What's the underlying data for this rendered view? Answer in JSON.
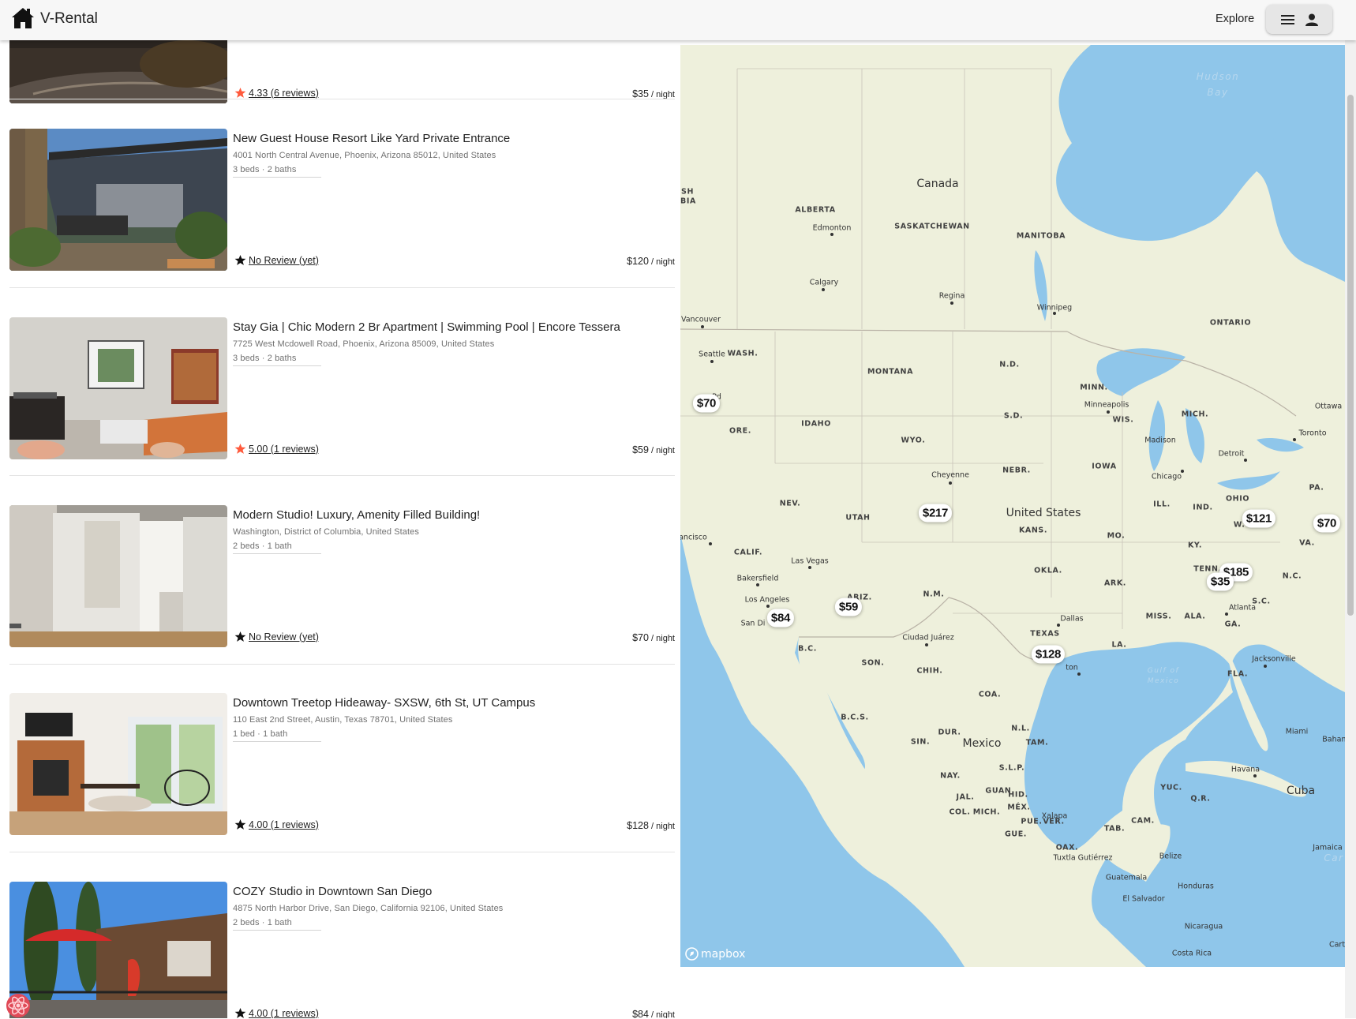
{
  "header": {
    "brand": "V-Rental",
    "explore_label": "Explore",
    "menu_icon": "hamburger-icon",
    "user_icon": "user-icon"
  },
  "listings": [
    {
      "title": "",
      "address": "",
      "beds": "",
      "rating": "4.33 (6 reviews)",
      "rated": true,
      "price": "$35",
      "per": " / night"
    },
    {
      "title": "New Guest House Resort Like Yard Private Entrance",
      "address": "4001 North Central Avenue, Phoenix, Arizona 85012, United States",
      "beds": "3 beds · 2 baths",
      "rating": "No Review (yet)",
      "rated": false,
      "price": "$120",
      "per": " / night"
    },
    {
      "title": "Stay Gia | Chic Modern 2 Br Apartment | Swimming Pool | Encore Tessera",
      "address": "7725 West Mcdowell Road, Phoenix, Arizona 85009, United States",
      "beds": "3 beds · 2 baths",
      "rating": "5.00 (1 reviews)",
      "rated": true,
      "price": "$59",
      "per": " / night"
    },
    {
      "title": "Modern Studio! Luxury, Amenity Filled Building!",
      "address": "Washington, District of Columbia, United States",
      "beds": "2 beds · 1 bath",
      "rating": "No Review (yet)",
      "rated": false,
      "price": "$70",
      "per": " / night"
    },
    {
      "title": "Downtown Treetop Hideaway- SXSW, 6th St, UT Campus",
      "address": "110 East 2nd Street, Austin, Texas 78701, United States",
      "beds": "1 bed · 1 bath",
      "rating": "4.00 (1 reviews)",
      "rated": false,
      "price": "$128",
      "per": " / night"
    },
    {
      "title": "COZY Studio in Downtown San Diego",
      "address": "4875 North Harbor Drive, San Diego, California 92106, United States",
      "beds": "2 beds · 1 bath",
      "rating": "4.00 (1 reviews)",
      "rated": false,
      "price": "$84",
      "per": " / night"
    }
  ],
  "colors": {
    "star_rated": "#ff5a3c",
    "star_unrated": "#111111",
    "water": "#8fc6ea",
    "land": "#eef0dc"
  },
  "map": {
    "attribution": "mapbox",
    "countries": [
      "Canada",
      "United States",
      "Mexico",
      "Cuba"
    ],
    "water_labels": [
      "Hudson",
      "Bay",
      "Gulf of",
      "Mexico",
      "Car"
    ],
    "states": [
      "ALBERTA",
      "SASKATCHEWAN",
      "MANITOBA",
      "ONTARIO",
      "SH",
      "BIA",
      "WASH.",
      "MONTANA",
      "N.D.",
      "MINN.",
      "ORE.",
      "IDAHO",
      "WYO.",
      "S.D.",
      "WIS.",
      "MICH.",
      "IOWA",
      "NEBR.",
      "NEV.",
      "UTAH",
      "KANS.",
      "MO.",
      "ILL.",
      "IND.",
      "OHIO",
      "PA.",
      "VA.",
      "KY.",
      "CALIF.",
      "ARIZ.",
      "N.M.",
      "OKLA.",
      "ARK.",
      "TENN.",
      "N.C.",
      "S.C.",
      "GA.",
      "ALA.",
      "MISS.",
      "LA.",
      "TEXAS",
      "FLA.",
      "B.C.",
      "SON.",
      "CHIH.",
      "COA.",
      "B.C.S.",
      "DUR.",
      "SIN.",
      "N.L.",
      "TAM.",
      "NAY.",
      "S.L.P.",
      "JAL.",
      "GUAN.",
      "HID.",
      "COL.",
      "MICH.",
      "MÉX.",
      "PUE.",
      "VER.",
      "GUE.",
      "OAX.",
      "TAB.",
      "CAM.",
      "YUC.",
      "Q.R.",
      "W.VA."
    ],
    "cities": [
      "Edmonton",
      "Calgary",
      "Regina",
      "Winnipeg",
      "Vancouver",
      "Seattle",
      "Minneapolis",
      "Ottawa",
      "Toronto",
      "Madison",
      "Detroit",
      "Chicago",
      "Cheyenne",
      "Las Vegas",
      "Bakersfield",
      "Los Angeles",
      "San Di",
      "Dallas",
      "Ciudad Juárez",
      "Atlanta",
      "Jacksonville",
      "Miami",
      "Havana",
      "Baham",
      "Jamaica",
      "Xalapa",
      "Tuxtla Gutiérrez",
      "Belize",
      "Guatemala",
      "Honduras",
      "El Salvador",
      "Nicaragua",
      "Costa Rica",
      "Cart",
      "rancisco",
      "ton",
      "Pd"
    ],
    "pins": [
      "$70",
      "$217",
      "$121",
      "$70",
      "$185",
      "$35",
      "$59",
      "$84",
      "$128"
    ]
  }
}
